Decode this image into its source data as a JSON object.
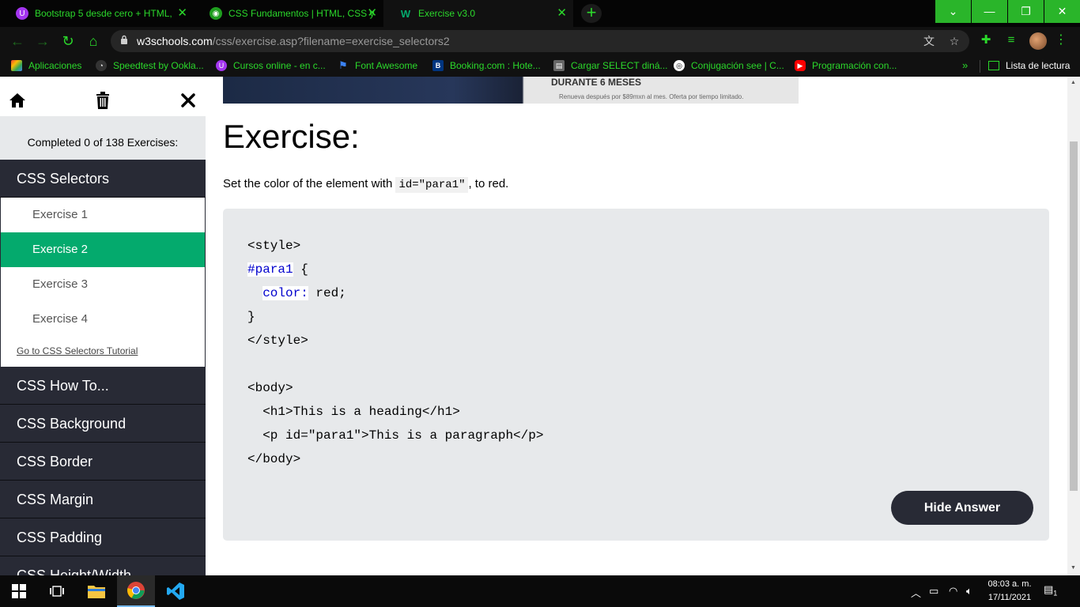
{
  "browser": {
    "tabs": [
      {
        "title": "Bootstrap 5 desde cero + HTML,",
        "favicon": "udemy-icon",
        "favicon_color": "#a435f0"
      },
      {
        "title": "CSS Fundamentos | HTML, CSS y",
        "favicon": "globe-icon",
        "favicon_color": "#2bd92b"
      },
      {
        "title": "Exercise v3.0",
        "favicon": "w3schools-icon",
        "favicon_color": "#04AA6D"
      }
    ],
    "new_tab": "+",
    "window_controls": {
      "minimize": "—",
      "restore": "❐",
      "close": "✕",
      "dropdown": "⌄"
    },
    "url_host": "w3schools.com",
    "url_path": "/css/exercise.asp?filename=exercise_selectors2",
    "bookmarks": [
      {
        "label": "Aplicaciones",
        "icon": "apps-grid-icon"
      },
      {
        "label": "Speedtest by Ookla...",
        "icon": "speedtest-icon"
      },
      {
        "label": "Cursos online - en c...",
        "icon": "udemy-icon"
      },
      {
        "label": "Font Awesome",
        "icon": "flag-icon"
      },
      {
        "label": "Booking.com : Hote...",
        "icon": "booking-icon"
      },
      {
        "label": "Cargar SELECT diná...",
        "icon": "doc-icon"
      },
      {
        "label": "Conjugación see | C...",
        "icon": "sd-icon"
      },
      {
        "label": "Programación con...",
        "icon": "youtube-icon"
      }
    ],
    "bookmarks_more": "»",
    "reading_list": "Lista de lectura"
  },
  "sidebar": {
    "completed_text": "Completed 0 of 138 Exercises:",
    "active_category": "CSS Selectors",
    "exercises": [
      "Exercise 1",
      "Exercise 2",
      "Exercise 3",
      "Exercise 4"
    ],
    "active_exercise_index": 1,
    "tutorial_link": "Go to CSS Selectors Tutorial",
    "categories": [
      "CSS How To...",
      "CSS Background",
      "CSS Border",
      "CSS Margin",
      "CSS Padding",
      "CSS Height/Width"
    ]
  },
  "ad": {
    "headline": "DURANTE 6 MESES",
    "fineprint": "Renueva después por $89mxn al mes. Oferta por tiempo limitado."
  },
  "exercise": {
    "title": "Exercise:",
    "desc_before": "Set the color of the element with ",
    "desc_code": "id=\"para1\"",
    "desc_after": ", to red.",
    "code_lines": {
      "l1": "<style>",
      "l2_sel": "#para1",
      "l2_rest": " {",
      "l3_indent": "  ",
      "l3_prop": "color:",
      "l3_rest": " red;",
      "l4": "}",
      "l5": "</style>",
      "l6": "",
      "l7": "<body>",
      "l8": "  <h1>This is a heading</h1>",
      "l9": "  <p id=\"para1\">This is a paragraph</p>",
      "l10": "</body>"
    },
    "hide_answer_label": "Hide Answer"
  },
  "taskbar": {
    "time": "08:03 a. m.",
    "date": "17/11/2021",
    "notification_count": "1"
  },
  "colors": {
    "accent_green": "#04AA6D",
    "sidebar_dark": "#282A35",
    "chrome_green": "#2bd92b"
  }
}
